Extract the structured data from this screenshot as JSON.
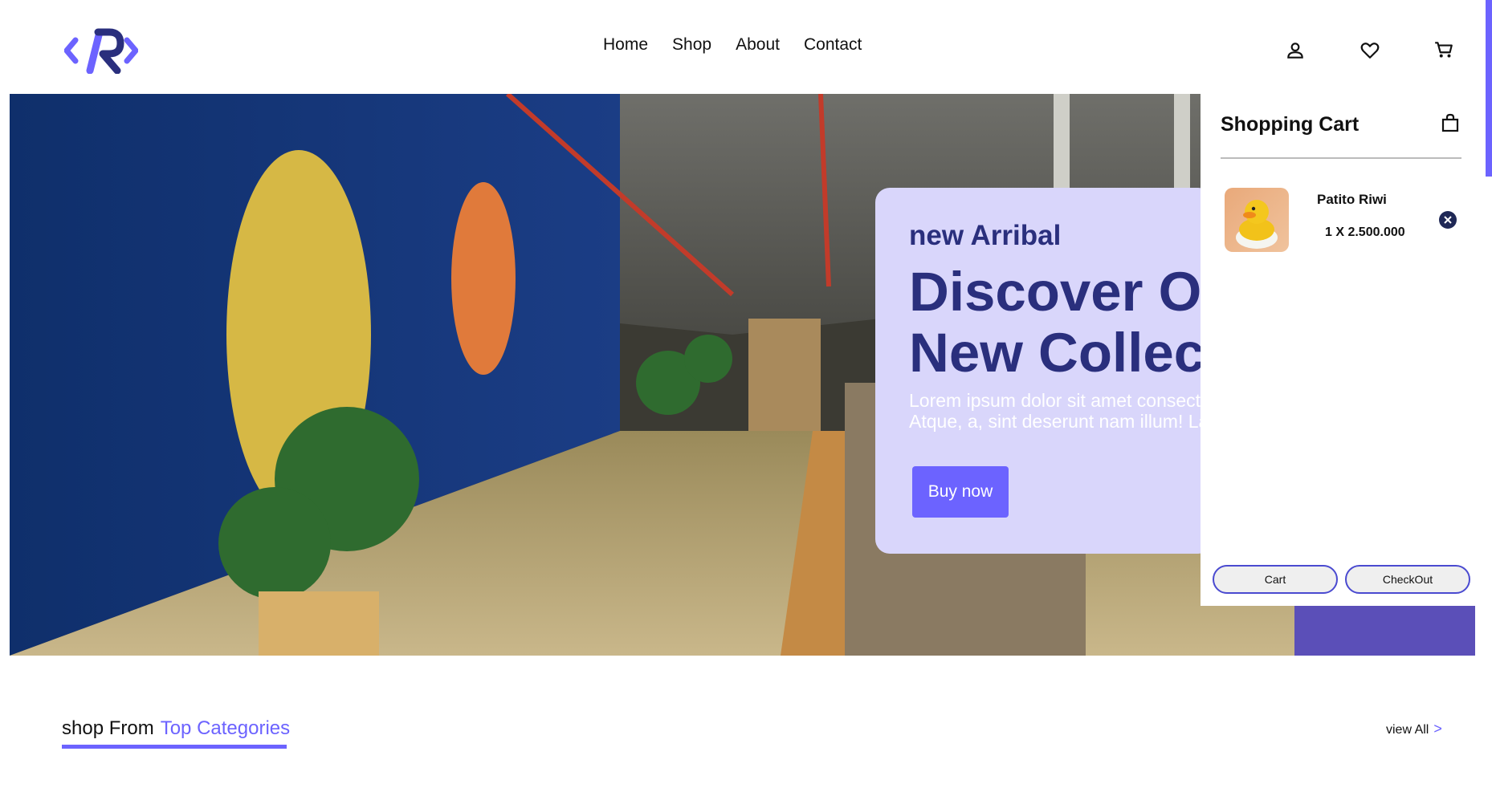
{
  "nav": {
    "items": [
      "Home",
      "Shop",
      "About",
      "Contact"
    ]
  },
  "header_icons": [
    "user-icon",
    "heart-icon",
    "cart-icon"
  ],
  "hero": {
    "eyebrow": "new Arribal",
    "headline_line1": "Discover Our",
    "headline_line2": "New Collection",
    "body": "Lorem ipsum dolor sit amet consectetur adipisicing elit. Atque, a, sint deserunt nam illum! Laborum",
    "cta": "Buy now"
  },
  "cart": {
    "title": "Shopping Cart",
    "items": [
      {
        "name": "Patito Riwi",
        "qty_price": "1 X 2.500.000"
      }
    ],
    "cart_button": "Cart",
    "checkout_button": "CheckOut"
  },
  "categories": {
    "prefix": "shop From",
    "accent": "Top Categories",
    "view_all": "view All",
    "view_all_icon": ">"
  },
  "colors": {
    "accent": "#6c63ff",
    "navy": "#2a2f7d",
    "promo_bg": "#d9d6fb",
    "dark": "#1f2856"
  }
}
